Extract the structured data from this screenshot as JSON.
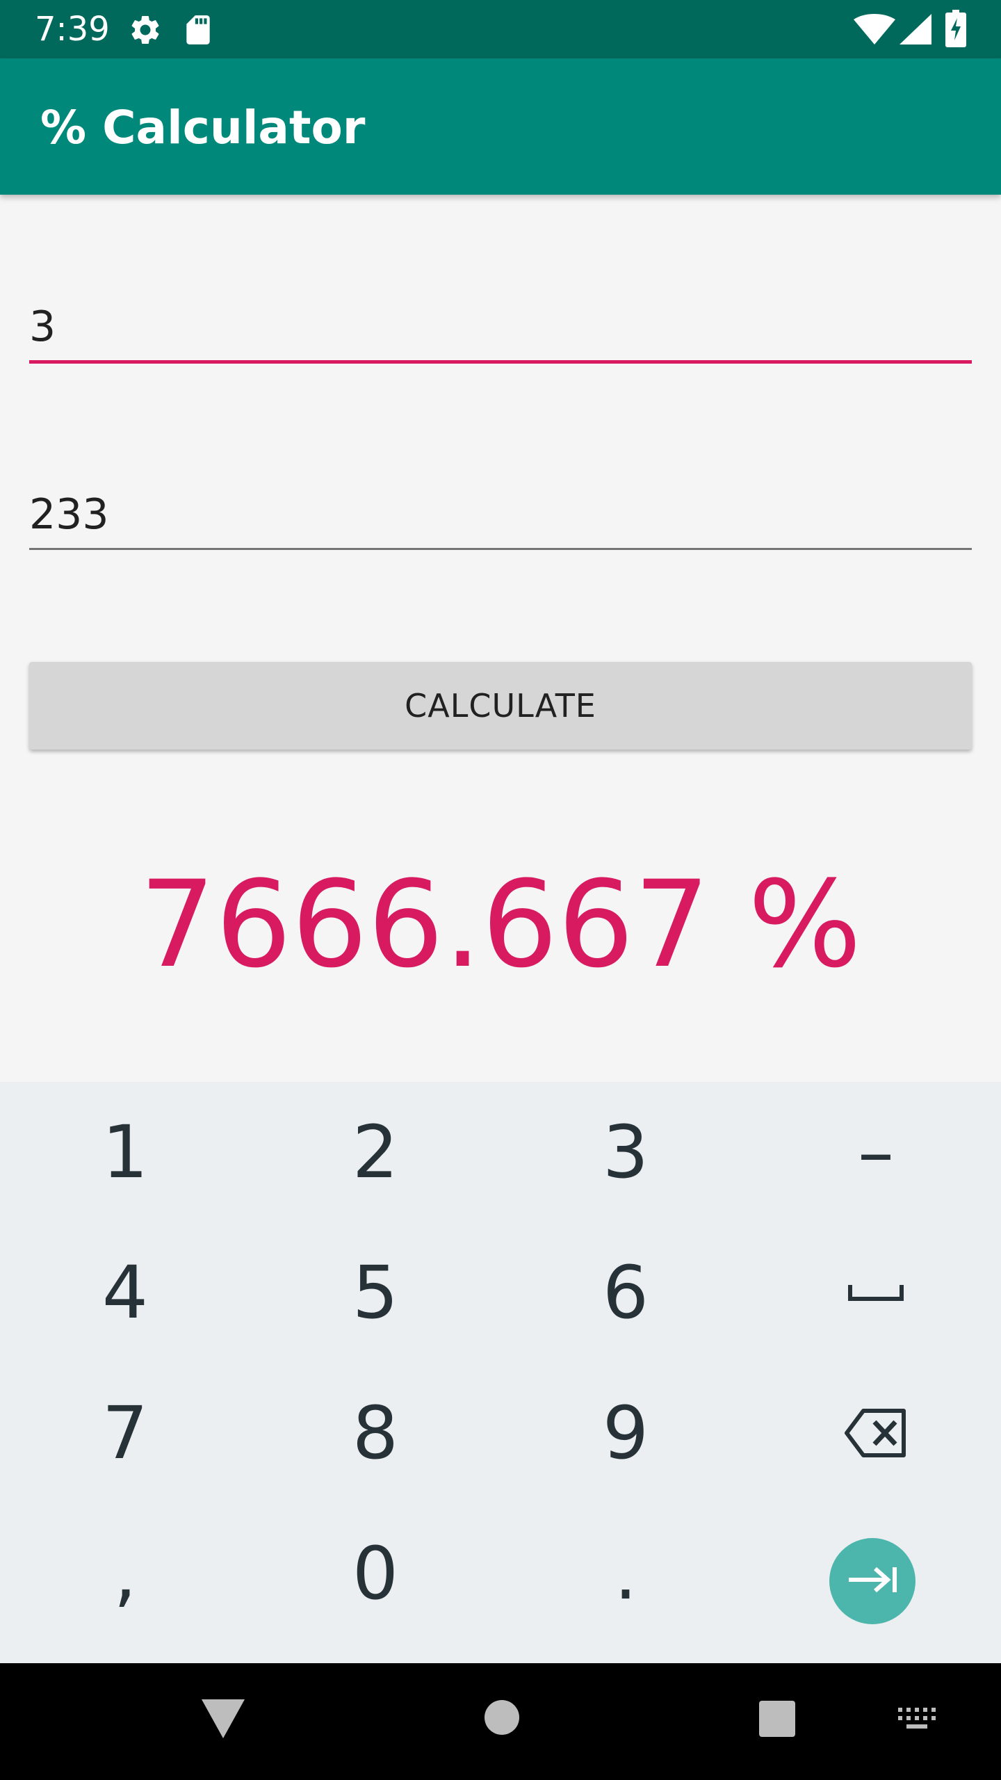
{
  "status_bar": {
    "time": "7:39",
    "icons": [
      "settings-icon",
      "sd-card-icon",
      "wifi-icon",
      "cell-signal-icon",
      "battery-charging-icon"
    ]
  },
  "app_bar": {
    "title": "% Calculator"
  },
  "form": {
    "first_value": "3",
    "second_value": "233",
    "calculate_label": "CALCULATE"
  },
  "result": {
    "text": "7666.667 %"
  },
  "keyboard": {
    "rows": [
      [
        "1",
        "2",
        "3",
        "–"
      ],
      [
        "4",
        "5",
        "6",
        "space-icon"
      ],
      [
        "7",
        "8",
        "9",
        "backspace-icon"
      ],
      [
        ",",
        "0",
        ".",
        "tab-next-icon"
      ]
    ]
  },
  "colors": {
    "status_bar": "#00695c",
    "app_bar": "#00897b",
    "accent": "#d81b60",
    "keyboard_bg": "#eceff1",
    "enter_key": "#4db6ac"
  },
  "nav_bar": {
    "buttons": [
      "back-icon",
      "home-icon",
      "recents-icon",
      "keyboard-switch-icon"
    ]
  }
}
